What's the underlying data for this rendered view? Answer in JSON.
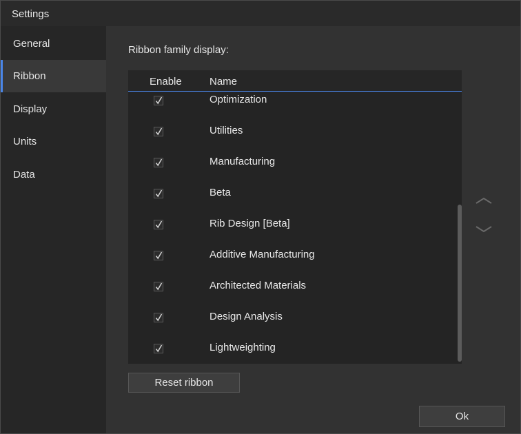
{
  "window": {
    "title": "Settings"
  },
  "sidebar": {
    "items": [
      {
        "label": "General",
        "selected": false
      },
      {
        "label": "Ribbon",
        "selected": true
      },
      {
        "label": "Display",
        "selected": false
      },
      {
        "label": "Units",
        "selected": false
      },
      {
        "label": "Data",
        "selected": false
      }
    ]
  },
  "ribbon": {
    "section_label": "Ribbon family display:",
    "columns": {
      "enable": "Enable",
      "name": "Name"
    },
    "rows": [
      {
        "name": "Optimization",
        "enabled": true
      },
      {
        "name": "Utilities",
        "enabled": true
      },
      {
        "name": "Manufacturing",
        "enabled": true
      },
      {
        "name": "Beta",
        "enabled": true
      },
      {
        "name": "Rib Design [Beta]",
        "enabled": true
      },
      {
        "name": "Additive Manufacturing",
        "enabled": true
      },
      {
        "name": "Architected Materials",
        "enabled": true
      },
      {
        "name": "Design Analysis",
        "enabled": true
      },
      {
        "name": "Lightweighting",
        "enabled": true
      }
    ],
    "reset_label": "Reset ribbon",
    "move_up_icon": "chevron-up-icon",
    "move_down_icon": "chevron-down-icon"
  },
  "footer": {
    "ok_label": "Ok"
  },
  "colors": {
    "accent": "#4a86e8",
    "background": "#323232",
    "sidebar": "#262626",
    "table": "#242424"
  }
}
